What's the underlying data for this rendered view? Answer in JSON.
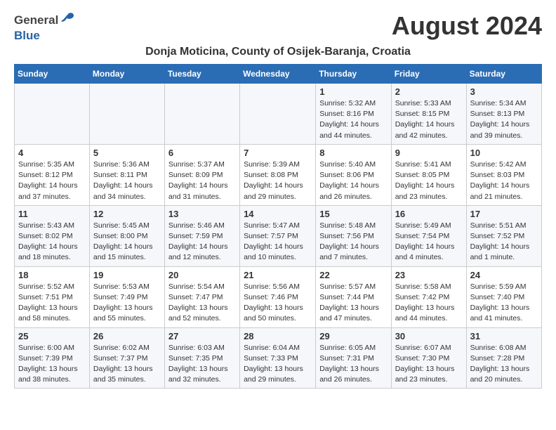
{
  "header": {
    "logo_general": "General",
    "logo_blue": "Blue",
    "month_year": "August 2024",
    "location": "Donja Moticina, County of Osijek-Baranja, Croatia"
  },
  "weekdays": [
    "Sunday",
    "Monday",
    "Tuesday",
    "Wednesday",
    "Thursday",
    "Friday",
    "Saturday"
  ],
  "weeks": [
    [
      {
        "day": "",
        "info": ""
      },
      {
        "day": "",
        "info": ""
      },
      {
        "day": "",
        "info": ""
      },
      {
        "day": "",
        "info": ""
      },
      {
        "day": "1",
        "info": "Sunrise: 5:32 AM\nSunset: 8:16 PM\nDaylight: 14 hours\nand 44 minutes."
      },
      {
        "day": "2",
        "info": "Sunrise: 5:33 AM\nSunset: 8:15 PM\nDaylight: 14 hours\nand 42 minutes."
      },
      {
        "day": "3",
        "info": "Sunrise: 5:34 AM\nSunset: 8:13 PM\nDaylight: 14 hours\nand 39 minutes."
      }
    ],
    [
      {
        "day": "4",
        "info": "Sunrise: 5:35 AM\nSunset: 8:12 PM\nDaylight: 14 hours\nand 37 minutes."
      },
      {
        "day": "5",
        "info": "Sunrise: 5:36 AM\nSunset: 8:11 PM\nDaylight: 14 hours\nand 34 minutes."
      },
      {
        "day": "6",
        "info": "Sunrise: 5:37 AM\nSunset: 8:09 PM\nDaylight: 14 hours\nand 31 minutes."
      },
      {
        "day": "7",
        "info": "Sunrise: 5:39 AM\nSunset: 8:08 PM\nDaylight: 14 hours\nand 29 minutes."
      },
      {
        "day": "8",
        "info": "Sunrise: 5:40 AM\nSunset: 8:06 PM\nDaylight: 14 hours\nand 26 minutes."
      },
      {
        "day": "9",
        "info": "Sunrise: 5:41 AM\nSunset: 8:05 PM\nDaylight: 14 hours\nand 23 minutes."
      },
      {
        "day": "10",
        "info": "Sunrise: 5:42 AM\nSunset: 8:03 PM\nDaylight: 14 hours\nand 21 minutes."
      }
    ],
    [
      {
        "day": "11",
        "info": "Sunrise: 5:43 AM\nSunset: 8:02 PM\nDaylight: 14 hours\nand 18 minutes."
      },
      {
        "day": "12",
        "info": "Sunrise: 5:45 AM\nSunset: 8:00 PM\nDaylight: 14 hours\nand 15 minutes."
      },
      {
        "day": "13",
        "info": "Sunrise: 5:46 AM\nSunset: 7:59 PM\nDaylight: 14 hours\nand 12 minutes."
      },
      {
        "day": "14",
        "info": "Sunrise: 5:47 AM\nSunset: 7:57 PM\nDaylight: 14 hours\nand 10 minutes."
      },
      {
        "day": "15",
        "info": "Sunrise: 5:48 AM\nSunset: 7:56 PM\nDaylight: 14 hours\nand 7 minutes."
      },
      {
        "day": "16",
        "info": "Sunrise: 5:49 AM\nSunset: 7:54 PM\nDaylight: 14 hours\nand 4 minutes."
      },
      {
        "day": "17",
        "info": "Sunrise: 5:51 AM\nSunset: 7:52 PM\nDaylight: 14 hours\nand 1 minute."
      }
    ],
    [
      {
        "day": "18",
        "info": "Sunrise: 5:52 AM\nSunset: 7:51 PM\nDaylight: 13 hours\nand 58 minutes."
      },
      {
        "day": "19",
        "info": "Sunrise: 5:53 AM\nSunset: 7:49 PM\nDaylight: 13 hours\nand 55 minutes."
      },
      {
        "day": "20",
        "info": "Sunrise: 5:54 AM\nSunset: 7:47 PM\nDaylight: 13 hours\nand 52 minutes."
      },
      {
        "day": "21",
        "info": "Sunrise: 5:56 AM\nSunset: 7:46 PM\nDaylight: 13 hours\nand 50 minutes."
      },
      {
        "day": "22",
        "info": "Sunrise: 5:57 AM\nSunset: 7:44 PM\nDaylight: 13 hours\nand 47 minutes."
      },
      {
        "day": "23",
        "info": "Sunrise: 5:58 AM\nSunset: 7:42 PM\nDaylight: 13 hours\nand 44 minutes."
      },
      {
        "day": "24",
        "info": "Sunrise: 5:59 AM\nSunset: 7:40 PM\nDaylight: 13 hours\nand 41 minutes."
      }
    ],
    [
      {
        "day": "25",
        "info": "Sunrise: 6:00 AM\nSunset: 7:39 PM\nDaylight: 13 hours\nand 38 minutes."
      },
      {
        "day": "26",
        "info": "Sunrise: 6:02 AM\nSunset: 7:37 PM\nDaylight: 13 hours\nand 35 minutes."
      },
      {
        "day": "27",
        "info": "Sunrise: 6:03 AM\nSunset: 7:35 PM\nDaylight: 13 hours\nand 32 minutes."
      },
      {
        "day": "28",
        "info": "Sunrise: 6:04 AM\nSunset: 7:33 PM\nDaylight: 13 hours\nand 29 minutes."
      },
      {
        "day": "29",
        "info": "Sunrise: 6:05 AM\nSunset: 7:31 PM\nDaylight: 13 hours\nand 26 minutes."
      },
      {
        "day": "30",
        "info": "Sunrise: 6:07 AM\nSunset: 7:30 PM\nDaylight: 13 hours\nand 23 minutes."
      },
      {
        "day": "31",
        "info": "Sunrise: 6:08 AM\nSunset: 7:28 PM\nDaylight: 13 hours\nand 20 minutes."
      }
    ]
  ]
}
